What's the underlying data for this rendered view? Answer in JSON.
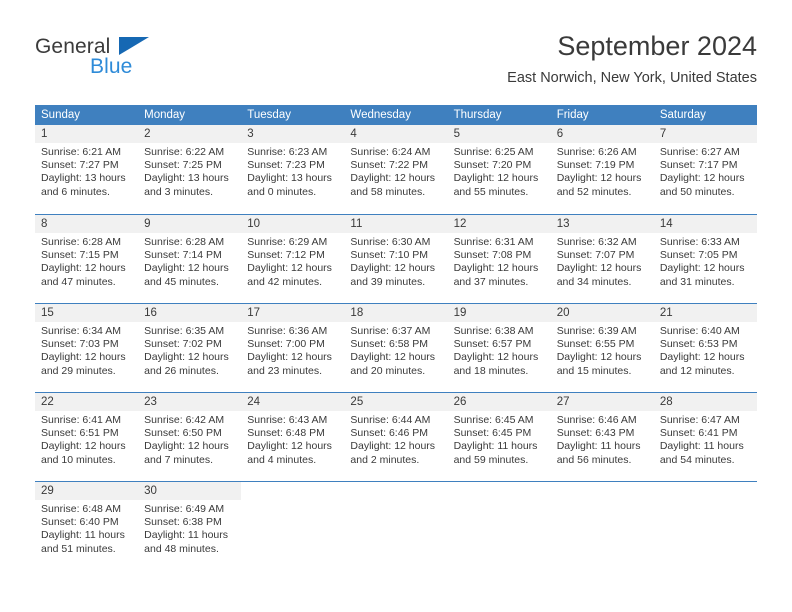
{
  "brand": {
    "name_part1": "General",
    "name_part2": "Blue",
    "triangle_color": "#1668b3",
    "blue_text_color": "#2e8bd8"
  },
  "header": {
    "title": "September 2024",
    "subtitle": "East Norwich, New York, United States"
  },
  "theme": {
    "header_blue": "#3f80bf",
    "daynum_band": "#f1f1f1",
    "text": "#3a3a3a"
  },
  "weekdays": [
    "Sunday",
    "Monday",
    "Tuesday",
    "Wednesday",
    "Thursday",
    "Friday",
    "Saturday"
  ],
  "weeks": [
    [
      {
        "day": "1",
        "sunrise": "Sunrise: 6:21 AM",
        "sunset": "Sunset: 7:27 PM",
        "daylight1": "Daylight: 13 hours",
        "daylight2": "and 6 minutes."
      },
      {
        "day": "2",
        "sunrise": "Sunrise: 6:22 AM",
        "sunset": "Sunset: 7:25 PM",
        "daylight1": "Daylight: 13 hours",
        "daylight2": "and 3 minutes."
      },
      {
        "day": "3",
        "sunrise": "Sunrise: 6:23 AM",
        "sunset": "Sunset: 7:23 PM",
        "daylight1": "Daylight: 13 hours",
        "daylight2": "and 0 minutes."
      },
      {
        "day": "4",
        "sunrise": "Sunrise: 6:24 AM",
        "sunset": "Sunset: 7:22 PM",
        "daylight1": "Daylight: 12 hours",
        "daylight2": "and 58 minutes."
      },
      {
        "day": "5",
        "sunrise": "Sunrise: 6:25 AM",
        "sunset": "Sunset: 7:20 PM",
        "daylight1": "Daylight: 12 hours",
        "daylight2": "and 55 minutes."
      },
      {
        "day": "6",
        "sunrise": "Sunrise: 6:26 AM",
        "sunset": "Sunset: 7:19 PM",
        "daylight1": "Daylight: 12 hours",
        "daylight2": "and 52 minutes."
      },
      {
        "day": "7",
        "sunrise": "Sunrise: 6:27 AM",
        "sunset": "Sunset: 7:17 PM",
        "daylight1": "Daylight: 12 hours",
        "daylight2": "and 50 minutes."
      }
    ],
    [
      {
        "day": "8",
        "sunrise": "Sunrise: 6:28 AM",
        "sunset": "Sunset: 7:15 PM",
        "daylight1": "Daylight: 12 hours",
        "daylight2": "and 47 minutes."
      },
      {
        "day": "9",
        "sunrise": "Sunrise: 6:28 AM",
        "sunset": "Sunset: 7:14 PM",
        "daylight1": "Daylight: 12 hours",
        "daylight2": "and 45 minutes."
      },
      {
        "day": "10",
        "sunrise": "Sunrise: 6:29 AM",
        "sunset": "Sunset: 7:12 PM",
        "daylight1": "Daylight: 12 hours",
        "daylight2": "and 42 minutes."
      },
      {
        "day": "11",
        "sunrise": "Sunrise: 6:30 AM",
        "sunset": "Sunset: 7:10 PM",
        "daylight1": "Daylight: 12 hours",
        "daylight2": "and 39 minutes."
      },
      {
        "day": "12",
        "sunrise": "Sunrise: 6:31 AM",
        "sunset": "Sunset: 7:08 PM",
        "daylight1": "Daylight: 12 hours",
        "daylight2": "and 37 minutes."
      },
      {
        "day": "13",
        "sunrise": "Sunrise: 6:32 AM",
        "sunset": "Sunset: 7:07 PM",
        "daylight1": "Daylight: 12 hours",
        "daylight2": "and 34 minutes."
      },
      {
        "day": "14",
        "sunrise": "Sunrise: 6:33 AM",
        "sunset": "Sunset: 7:05 PM",
        "daylight1": "Daylight: 12 hours",
        "daylight2": "and 31 minutes."
      }
    ],
    [
      {
        "day": "15",
        "sunrise": "Sunrise: 6:34 AM",
        "sunset": "Sunset: 7:03 PM",
        "daylight1": "Daylight: 12 hours",
        "daylight2": "and 29 minutes."
      },
      {
        "day": "16",
        "sunrise": "Sunrise: 6:35 AM",
        "sunset": "Sunset: 7:02 PM",
        "daylight1": "Daylight: 12 hours",
        "daylight2": "and 26 minutes."
      },
      {
        "day": "17",
        "sunrise": "Sunrise: 6:36 AM",
        "sunset": "Sunset: 7:00 PM",
        "daylight1": "Daylight: 12 hours",
        "daylight2": "and 23 minutes."
      },
      {
        "day": "18",
        "sunrise": "Sunrise: 6:37 AM",
        "sunset": "Sunset: 6:58 PM",
        "daylight1": "Daylight: 12 hours",
        "daylight2": "and 20 minutes."
      },
      {
        "day": "19",
        "sunrise": "Sunrise: 6:38 AM",
        "sunset": "Sunset: 6:57 PM",
        "daylight1": "Daylight: 12 hours",
        "daylight2": "and 18 minutes."
      },
      {
        "day": "20",
        "sunrise": "Sunrise: 6:39 AM",
        "sunset": "Sunset: 6:55 PM",
        "daylight1": "Daylight: 12 hours",
        "daylight2": "and 15 minutes."
      },
      {
        "day": "21",
        "sunrise": "Sunrise: 6:40 AM",
        "sunset": "Sunset: 6:53 PM",
        "daylight1": "Daylight: 12 hours",
        "daylight2": "and 12 minutes."
      }
    ],
    [
      {
        "day": "22",
        "sunrise": "Sunrise: 6:41 AM",
        "sunset": "Sunset: 6:51 PM",
        "daylight1": "Daylight: 12 hours",
        "daylight2": "and 10 minutes."
      },
      {
        "day": "23",
        "sunrise": "Sunrise: 6:42 AM",
        "sunset": "Sunset: 6:50 PM",
        "daylight1": "Daylight: 12 hours",
        "daylight2": "and 7 minutes."
      },
      {
        "day": "24",
        "sunrise": "Sunrise: 6:43 AM",
        "sunset": "Sunset: 6:48 PM",
        "daylight1": "Daylight: 12 hours",
        "daylight2": "and 4 minutes."
      },
      {
        "day": "25",
        "sunrise": "Sunrise: 6:44 AM",
        "sunset": "Sunset: 6:46 PM",
        "daylight1": "Daylight: 12 hours",
        "daylight2": "and 2 minutes."
      },
      {
        "day": "26",
        "sunrise": "Sunrise: 6:45 AM",
        "sunset": "Sunset: 6:45 PM",
        "daylight1": "Daylight: 11 hours",
        "daylight2": "and 59 minutes."
      },
      {
        "day": "27",
        "sunrise": "Sunrise: 6:46 AM",
        "sunset": "Sunset: 6:43 PM",
        "daylight1": "Daylight: 11 hours",
        "daylight2": "and 56 minutes."
      },
      {
        "day": "28",
        "sunrise": "Sunrise: 6:47 AM",
        "sunset": "Sunset: 6:41 PM",
        "daylight1": "Daylight: 11 hours",
        "daylight2": "and 54 minutes."
      }
    ],
    [
      {
        "day": "29",
        "sunrise": "Sunrise: 6:48 AM",
        "sunset": "Sunset: 6:40 PM",
        "daylight1": "Daylight: 11 hours",
        "daylight2": "and 51 minutes."
      },
      {
        "day": "30",
        "sunrise": "Sunrise: 6:49 AM",
        "sunset": "Sunset: 6:38 PM",
        "daylight1": "Daylight: 11 hours",
        "daylight2": "and 48 minutes."
      },
      {
        "day": "",
        "sunrise": "",
        "sunset": "",
        "daylight1": "",
        "daylight2": ""
      },
      {
        "day": "",
        "sunrise": "",
        "sunset": "",
        "daylight1": "",
        "daylight2": ""
      },
      {
        "day": "",
        "sunrise": "",
        "sunset": "",
        "daylight1": "",
        "daylight2": ""
      },
      {
        "day": "",
        "sunrise": "",
        "sunset": "",
        "daylight1": "",
        "daylight2": ""
      },
      {
        "day": "",
        "sunrise": "",
        "sunset": "",
        "daylight1": "",
        "daylight2": ""
      }
    ]
  ]
}
